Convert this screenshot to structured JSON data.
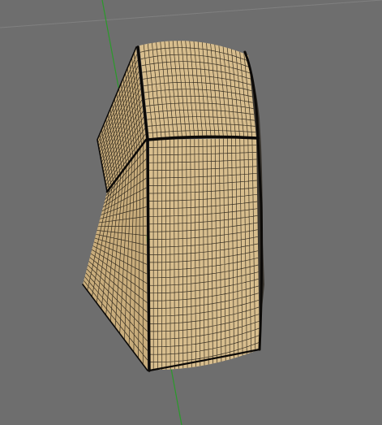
{
  "viewport": {
    "background_color": "#6e6e6e",
    "grid_line_color": "#808080",
    "axis_y_color": "#2a9a2a"
  },
  "mesh": {
    "surface_color": "#d8be8e",
    "surface_shade_color": "#c9ad7c",
    "wire_color": "#1c1710",
    "edge_color": "#0c0a08",
    "shadow_color": "#3a3630"
  }
}
